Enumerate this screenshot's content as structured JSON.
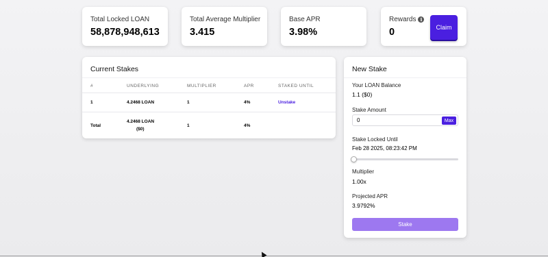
{
  "stats": {
    "total_locked_label": "Total Locked LOAN",
    "total_locked_value": "58,878,948,613",
    "avg_multiplier_label": "Total Average Multiplier",
    "avg_multiplier_value": "3.415",
    "base_apr_label": "Base APR",
    "base_apr_value": "3.98%",
    "rewards_label": "Rewards",
    "rewards_value": "0",
    "claim_label": "Claim",
    "info_icon": "info-icon"
  },
  "current_stakes": {
    "title": "Current Stakes",
    "headers": [
      "#",
      "UNDERLYING",
      "MULTIPLIER",
      "APR",
      "STAKED UNTIL"
    ],
    "rows": [
      {
        "id": "1",
        "underlying": "4.2468 LOAN",
        "multiplier": "1",
        "apr": "4%",
        "action": "Unstake"
      }
    ],
    "total": {
      "label": "Total",
      "underlying": "4.2468 LOAN",
      "underlying_usd": "($0)",
      "multiplier": "1",
      "apr": "4%"
    }
  },
  "new_stake": {
    "title": "New Stake",
    "balance_label": "Your LOAN Balance",
    "balance_value": "1.1 ($0)",
    "amount_label": "Stake Amount",
    "amount_value": "0",
    "max_label": "Max",
    "locked_until_label": "Stake Locked Until",
    "locked_until_value": "Feb 28 2025, 08:23:42 PM",
    "multiplier_label": "Multiplier",
    "multiplier_value": "1.00x",
    "projected_apr_label": "Projected APR",
    "projected_apr_value": "3.9792%",
    "stake_button_label": "Stake",
    "slider_position": 0
  },
  "colors": {
    "accent": "#4a1fe0",
    "stake_button": "#9d78f0"
  }
}
